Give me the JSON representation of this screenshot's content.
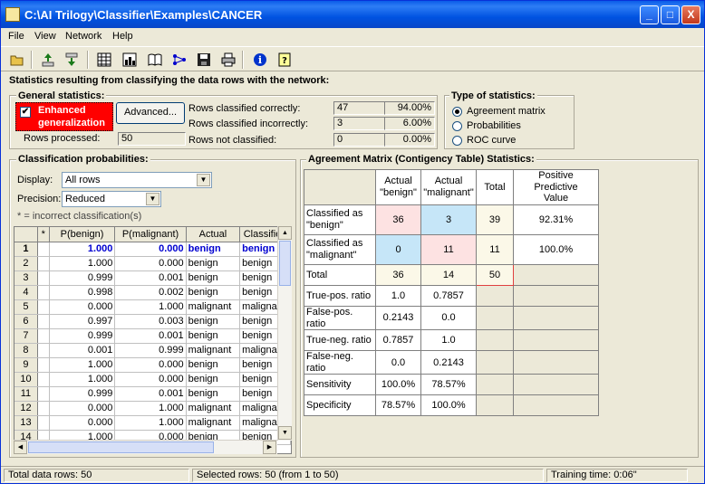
{
  "window": {
    "title": "C:\\AI Trilogy\\Classifier\\Examples\\CANCER",
    "minimize": "_",
    "maximize": "□",
    "close": "X"
  },
  "menu": [
    "File",
    "View",
    "Network",
    "Help"
  ],
  "toolbar_icons": [
    "open-folder-icon",
    "import-icon",
    "export-icon",
    "table-icon",
    "chart-icon",
    "book-icon",
    "network-icon",
    "save-icon",
    "print-icon",
    "info-icon",
    "help-icon"
  ],
  "main_heading": "Statistics resulting from classifying the data rows with the network:",
  "general": {
    "heading": "General statistics:",
    "enhanced_line1": "Enhanced",
    "enhanced_line2": "generalization",
    "enhanced_checked": true,
    "advanced_button": "Advanced...",
    "rows_processed_label": "Rows processed:",
    "rows_processed": "50",
    "stats": [
      {
        "label": "Rows classified correctly:",
        "count": "47",
        "pct": "94.00%"
      },
      {
        "label": "Rows classified incorrectly:",
        "count": "3",
        "pct": "6.00%"
      },
      {
        "label": "Rows not classified:",
        "count": "0",
        "pct": "0.00%"
      }
    ]
  },
  "type_of_stats": {
    "heading": "Type of statistics:",
    "options": [
      "Agreement matrix",
      "Probabilities",
      "ROC curve"
    ],
    "selected": 0
  },
  "probabilities": {
    "heading": "Classification probabilities:",
    "display_label": "Display:",
    "display_value": "All rows",
    "precision_label": "Precision:",
    "precision_value": "Reduced",
    "note": "* = incorrect classification(s)",
    "columns": [
      "",
      "*",
      "P(benign)",
      "P(malignant)",
      "Actual",
      "Classified"
    ],
    "rows": [
      [
        "1",
        "",
        "1.000",
        "0.000",
        "benign",
        "benign"
      ],
      [
        "2",
        "",
        "1.000",
        "0.000",
        "benign",
        "benign"
      ],
      [
        "3",
        "",
        "0.999",
        "0.001",
        "benign",
        "benign"
      ],
      [
        "4",
        "",
        "0.998",
        "0.002",
        "benign",
        "benign"
      ],
      [
        "5",
        "",
        "0.000",
        "1.000",
        "malignant",
        "malignant"
      ],
      [
        "6",
        "",
        "0.997",
        "0.003",
        "benign",
        "benign"
      ],
      [
        "7",
        "",
        "0.999",
        "0.001",
        "benign",
        "benign"
      ],
      [
        "8",
        "",
        "0.001",
        "0.999",
        "malignant",
        "malignant"
      ],
      [
        "9",
        "",
        "1.000",
        "0.000",
        "benign",
        "benign"
      ],
      [
        "10",
        "",
        "1.000",
        "0.000",
        "benign",
        "benign"
      ],
      [
        "11",
        "",
        "0.999",
        "0.001",
        "benign",
        "benign"
      ],
      [
        "12",
        "",
        "0.000",
        "1.000",
        "malignant",
        "malignant"
      ],
      [
        "13",
        "",
        "0.000",
        "1.000",
        "malignant",
        "malignant"
      ],
      [
        "14",
        "",
        "1.000",
        "0.000",
        "benign",
        "benign"
      ]
    ]
  },
  "agreement": {
    "heading": "Agreement Matrix (Contigency Table) Statistics:",
    "col_actual_benign": [
      "Actual",
      "\"benign\""
    ],
    "col_actual_malignant": [
      "Actual",
      "\"malignant\""
    ],
    "col_total": "Total",
    "col_ppv": [
      "Positive Predictive",
      "Value"
    ],
    "row_benign": [
      "Classified as",
      "\"benign\""
    ],
    "row_malignant": [
      "Classified as",
      "\"malignant\""
    ],
    "row_total": "Total",
    "cells": {
      "bb": "36",
      "bm": "3",
      "btot": "39",
      "bppv": "92.31%",
      "mb": "0",
      "mm": "11",
      "mtot": "11",
      "mppv": "100.0%",
      "tb": "36",
      "tm": "14",
      "tt": "50"
    },
    "ratios": [
      {
        "label": "True-pos. ratio",
        "b": "1.0",
        "m": "0.7857"
      },
      {
        "label": "False-pos. ratio",
        "b": "0.2143",
        "m": "0.0"
      },
      {
        "label": "True-neg. ratio",
        "b": "0.7857",
        "m": "1.0"
      },
      {
        "label": "False-neg. ratio",
        "b": "0.0",
        "m": "0.2143"
      },
      {
        "label": "Sensitivity",
        "b": "100.0%",
        "m": "78.57%"
      },
      {
        "label": "Specificity",
        "b": "78.57%",
        "m": "100.0%"
      }
    ]
  },
  "status": {
    "total": "Total data rows: 50",
    "selected": "Selected rows: 50  (from 1 to 50)",
    "training": "Training time: 0:06\""
  }
}
